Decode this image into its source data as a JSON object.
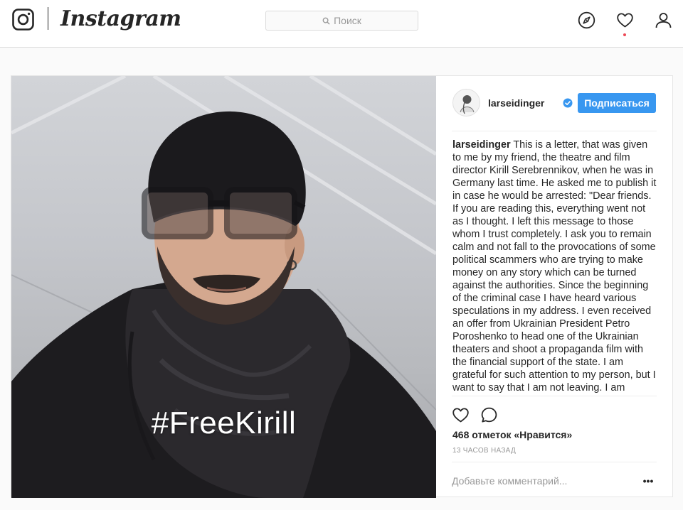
{
  "nav": {
    "wordmark": "Instagram",
    "search_placeholder": "Поиск",
    "icons": [
      "instagram-logo-icon",
      "search-icon",
      "compass-icon",
      "heart-icon",
      "profile-icon"
    ],
    "has_notification": true
  },
  "post": {
    "username": "larseidinger",
    "verified": true,
    "follow_label": "Подписаться",
    "image_caption": "#FreeKirill",
    "caption_username": "larseidinger",
    "caption_text": "This is a letter, that was given to me by my friend, the theatre and film director Kirill Serebrennikov, when he was in Germany last time. He asked me to publish it in case he would be arrested: \"Dear friends. If you are reading this, everything went not as I thought. I left this message to those whom I trust completely. I ask you to remain calm and not fall to the provocations of some political scammers who are trying to make money on any story which can be turned against the authorities. Since the beginning of the criminal case I have heard various speculations in my address. I even received an offer from Ukrainian President Petro Poroshenko to head one of the Ukrainian theaters and shoot a propaganda film with the financial support of the state. I am grateful for such attention to my person, but I want to say that I am not leaving. I am",
    "likes_text": "468 отметок «Нравится»",
    "timestamp": "13 ЧАСОВ НАЗАД",
    "comment_placeholder": "Добавьте комментарий...",
    "more_label": "•••"
  },
  "colors": {
    "accent": "#3897f0",
    "text": "#262626",
    "muted": "#999999",
    "border": "#dbdbdb",
    "background": "#fafafa",
    "notification": "#ed4956"
  }
}
